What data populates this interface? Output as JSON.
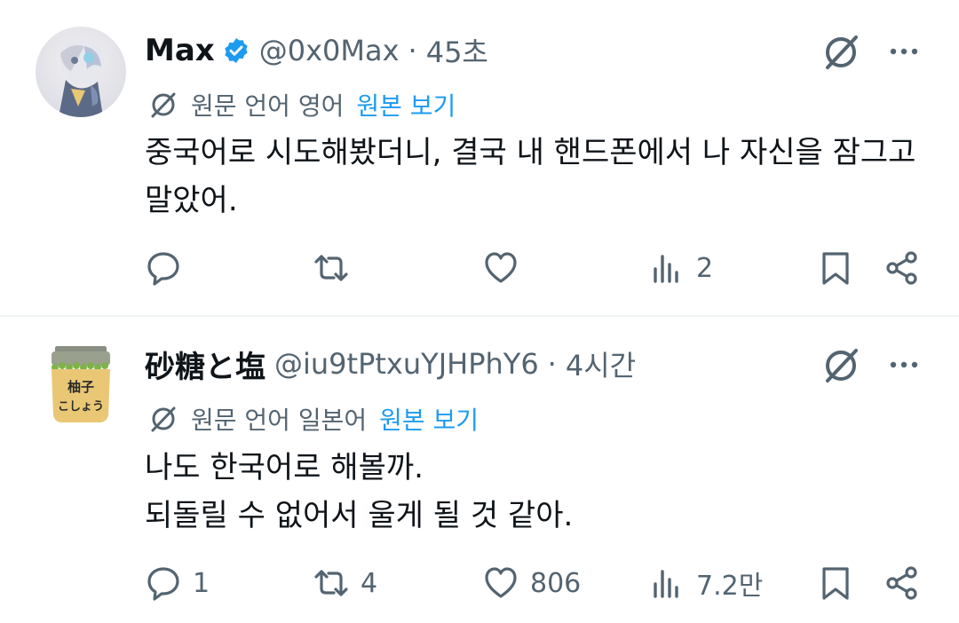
{
  "tweets": [
    {
      "name": "Max",
      "verified": true,
      "handle": "@0x0Max",
      "separator": "·",
      "time": "45초",
      "translate_label": "원문 언어 영어",
      "original_link": "원본 보기",
      "body_lines": [
        "중국어로 시도해봤더니, 결국 내 핸드폰에서 나 자신을 잠그고",
        "말았어."
      ],
      "counts": {
        "reply": "",
        "retweet": "",
        "like": "",
        "views": "2"
      }
    },
    {
      "name": "砂糖と塩",
      "verified": false,
      "handle": "@iu9tPtxuYJHPhY6",
      "separator": "·",
      "time": "4시간",
      "translate_label": "원문 언어 일본어",
      "original_link": "원본 보기",
      "avatar_text": [
        "柚子",
        "こしょう"
      ],
      "body_lines": [
        "나도 한국어로 해볼까.",
        "되돌릴 수 없어서 울게 될 것 같아."
      ],
      "counts": {
        "reply": "1",
        "retweet": "4",
        "like": "806",
        "views": "7.2만"
      }
    }
  ],
  "colors": {
    "text": "#0f1419",
    "secondary": "#536471",
    "link": "#1d9bf0",
    "verified": "#1d9bf0",
    "divider": "#eff3f4"
  },
  "icons": [
    "verified-badge-icon",
    "grok-icon",
    "more-icon",
    "translate-icon",
    "reply-icon",
    "retweet-icon",
    "like-icon",
    "views-icon",
    "bookmark-icon",
    "share-icon"
  ]
}
